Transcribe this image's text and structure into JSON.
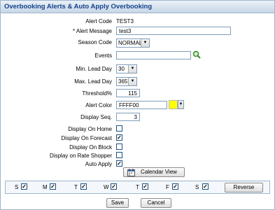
{
  "window": {
    "title": "Overbooking Alerts & Auto Apply Overbooking"
  },
  "fields": {
    "alert_code": {
      "label": "Alert Code",
      "value": "TEST3"
    },
    "alert_message": {
      "label": "* Alert Message",
      "value": "test3"
    },
    "season_code": {
      "label": "Season Code",
      "value": "NORMAL"
    },
    "events": {
      "label": "Events",
      "value": ""
    },
    "min_lead_day": {
      "label": "Min. Lead Day",
      "value": "30"
    },
    "max_lead_day": {
      "label": "Max. Lead Day",
      "value": "365"
    },
    "threshold": {
      "label": "Threshold%",
      "value": "115"
    },
    "alert_color": {
      "label": "Alert Color",
      "value": "FFFF00",
      "swatch": "#ffff00"
    },
    "display_seq": {
      "label": "Display Seq.",
      "value": "3"
    }
  },
  "checkboxes": [
    {
      "label": "Display On Home",
      "checked": false
    },
    {
      "label": "Display On Forecast",
      "checked": true
    },
    {
      "label": "Display On Block",
      "checked": false
    },
    {
      "label": "Display on Rate Shopper",
      "checked": false
    },
    {
      "label": "Auto Apply",
      "checked": true
    }
  ],
  "calendar_button": {
    "label": "Calendar View",
    "icon": "calendar-icon"
  },
  "days": [
    {
      "label": "S",
      "checked": true
    },
    {
      "label": "M",
      "checked": true
    },
    {
      "label": "T",
      "checked": true
    },
    {
      "label": "W",
      "checked": true
    },
    {
      "label": "T",
      "checked": true
    },
    {
      "label": "F",
      "checked": true
    },
    {
      "label": "S",
      "checked": true
    }
  ],
  "reverse_button": {
    "label": "Reverse"
  },
  "actions": {
    "save": "Save",
    "cancel": "Cancel"
  },
  "icons": {
    "events_search": "search-icon"
  }
}
